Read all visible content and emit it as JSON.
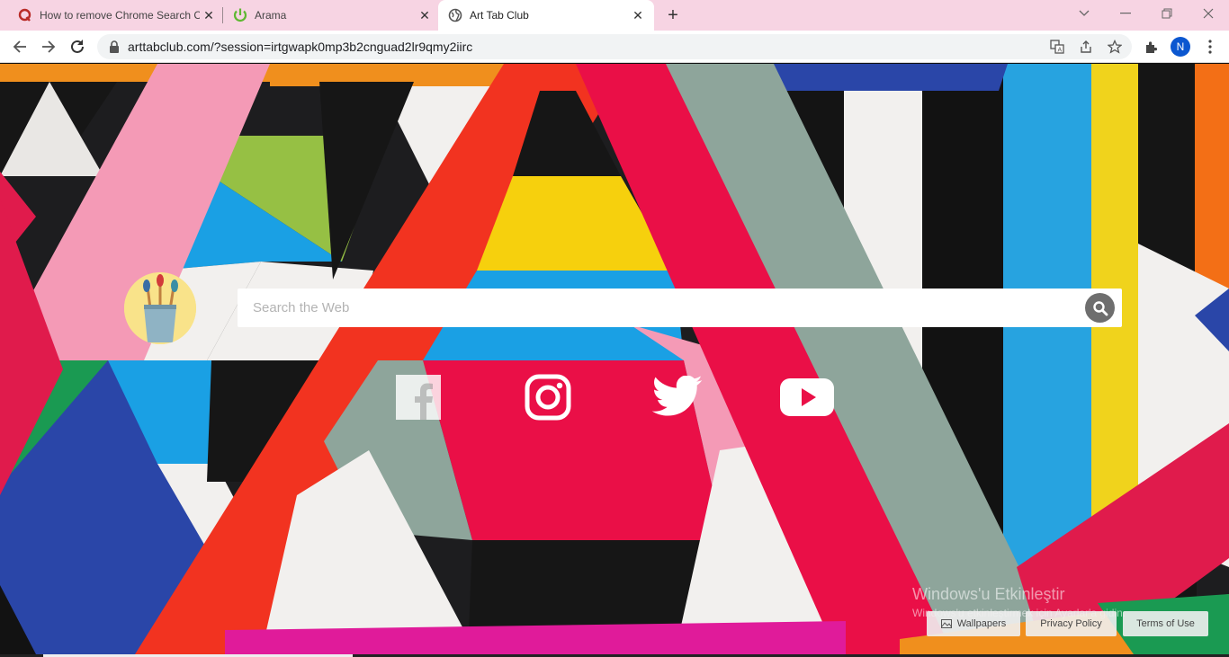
{
  "tabs": [
    {
      "title": "How to remove Chrome Search Co",
      "favicon": "quora-icon"
    },
    {
      "title": "Arama",
      "favicon": "power-icon"
    },
    {
      "title": "Art Tab Club",
      "favicon": "globe-icon"
    }
  ],
  "address_bar": {
    "url": "arttabclub.com/?session=irtgwapk0mp3b2cnguad2lr9qmy2iirc"
  },
  "profile": {
    "initial": "N"
  },
  "search": {
    "placeholder": "Search the Web"
  },
  "social_links": [
    "facebook-icon",
    "instagram-icon",
    "twitter-icon",
    "youtube-icon"
  ],
  "activation_notice": {
    "title": "Windows'u Etkinleştir",
    "subtitle": "Windows'u etkinleştirmek için Ayarlar'a gidin."
  },
  "footer": {
    "wallpapers": "Wallpapers",
    "privacy": "Privacy Policy",
    "terms": "Terms of Use"
  },
  "colors": {
    "tab_strip": "#f7d4e3",
    "profile_avatar": "#0b57d0",
    "quora_red": "#b92b27",
    "power_green": "#5fb832"
  }
}
